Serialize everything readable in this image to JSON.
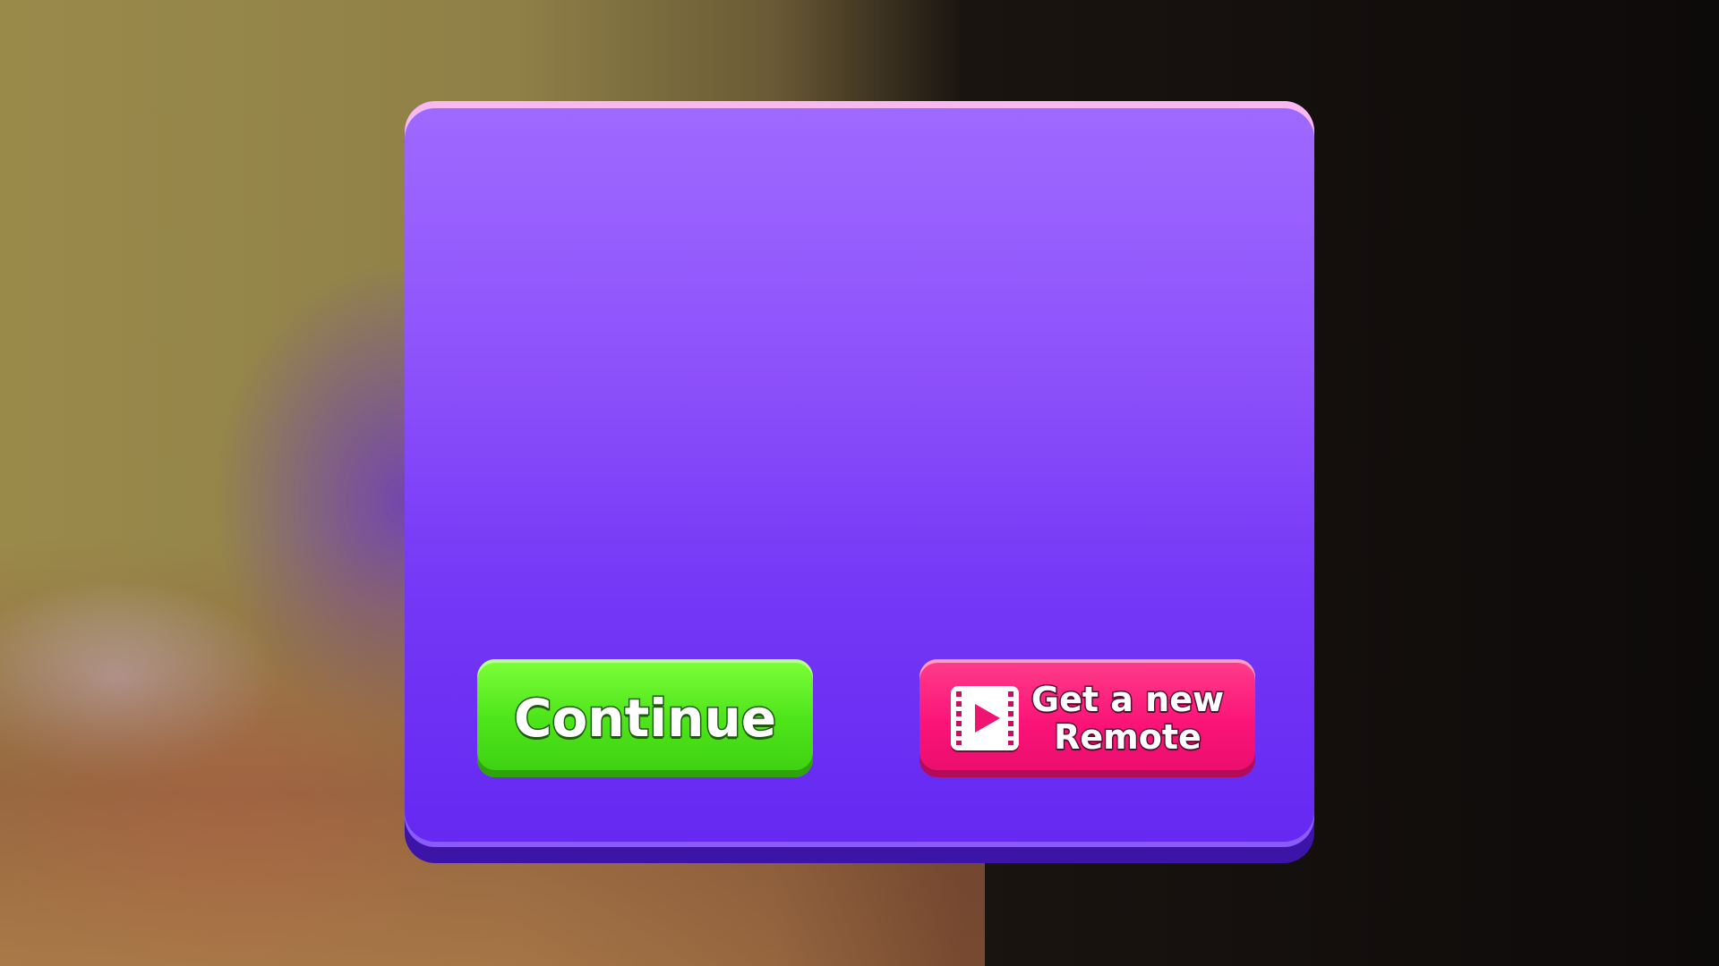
{
  "dialog": {
    "continue_label": "Continue",
    "get_remote_label_line1": "Get a new",
    "get_remote_label_line2": "Remote",
    "get_remote_icon": "video-ad-icon"
  },
  "colors": {
    "panel": "#8a4ffa",
    "continue": "#4fe51a",
    "get_remote": "#fb1378"
  }
}
